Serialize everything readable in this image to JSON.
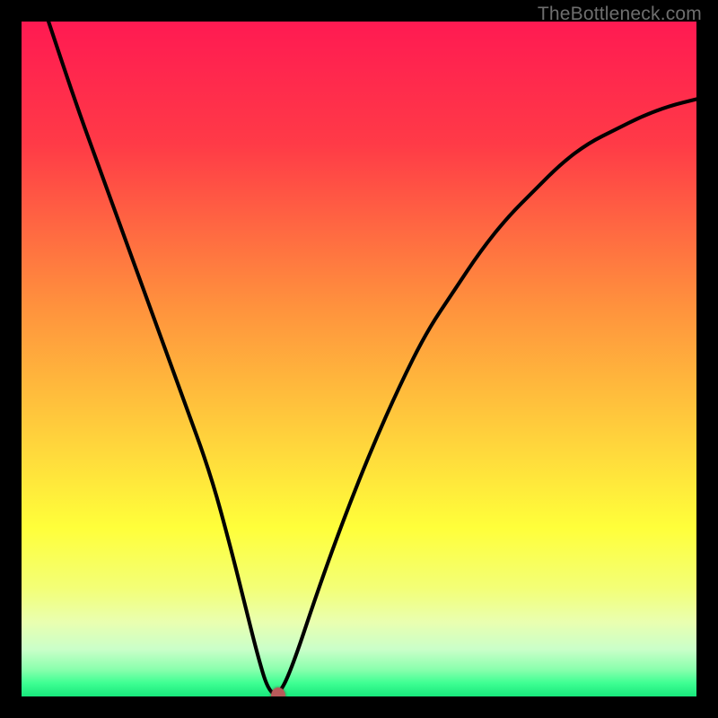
{
  "watermark": "TheBottleneck.com",
  "chart_data": {
    "type": "line",
    "title": "",
    "xlabel": "",
    "ylabel": "",
    "xlim": [
      0,
      100
    ],
    "ylim": [
      0,
      100
    ],
    "series": [
      {
        "name": "bottleneck-curve",
        "x": [
          4,
          8,
          12,
          16,
          20,
          24,
          28,
          31,
          33,
          35,
          36.5,
          38,
          40,
          44,
          48,
          52,
          56,
          60,
          64,
          68,
          72,
          76,
          80,
          84,
          88,
          92,
          96,
          100
        ],
        "y": [
          100,
          88,
          77,
          66,
          55,
          44,
          33,
          22,
          14,
          6,
          1,
          0,
          4,
          16,
          27,
          37,
          46,
          54,
          60,
          66,
          71,
          75,
          79,
          82,
          84,
          86,
          87.5,
          88.5
        ]
      }
    ],
    "marker": {
      "x": 38,
      "y": 0
    },
    "gradient_stops": [
      {
        "offset": 0,
        "color": "#ff1a52"
      },
      {
        "offset": 18,
        "color": "#ff3a47"
      },
      {
        "offset": 42,
        "color": "#ff913d"
      },
      {
        "offset": 62,
        "color": "#ffd33c"
      },
      {
        "offset": 75,
        "color": "#ffff3a"
      },
      {
        "offset": 84,
        "color": "#f3ff77"
      },
      {
        "offset": 89,
        "color": "#e9ffb0"
      },
      {
        "offset": 93,
        "color": "#caffc9"
      },
      {
        "offset": 96,
        "color": "#8affad"
      },
      {
        "offset": 98,
        "color": "#3fff93"
      },
      {
        "offset": 100,
        "color": "#17e87c"
      }
    ]
  }
}
